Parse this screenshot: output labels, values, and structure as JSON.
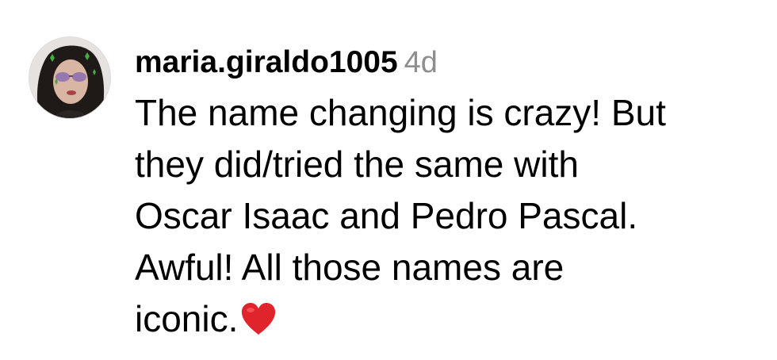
{
  "comment": {
    "username": "maria.giraldo1005",
    "time": "4d",
    "text_lines": [
      "The name changing is crazy! But",
      "they did/tried the same with",
      "Oscar Isaac and Pedro Pascal.",
      "Awful! All those names are",
      "iconic."
    ],
    "emoji": "red-heart-icon",
    "colors": {
      "username": "#000000",
      "time": "#8e8e8e",
      "heart": "#e0242c"
    }
  }
}
